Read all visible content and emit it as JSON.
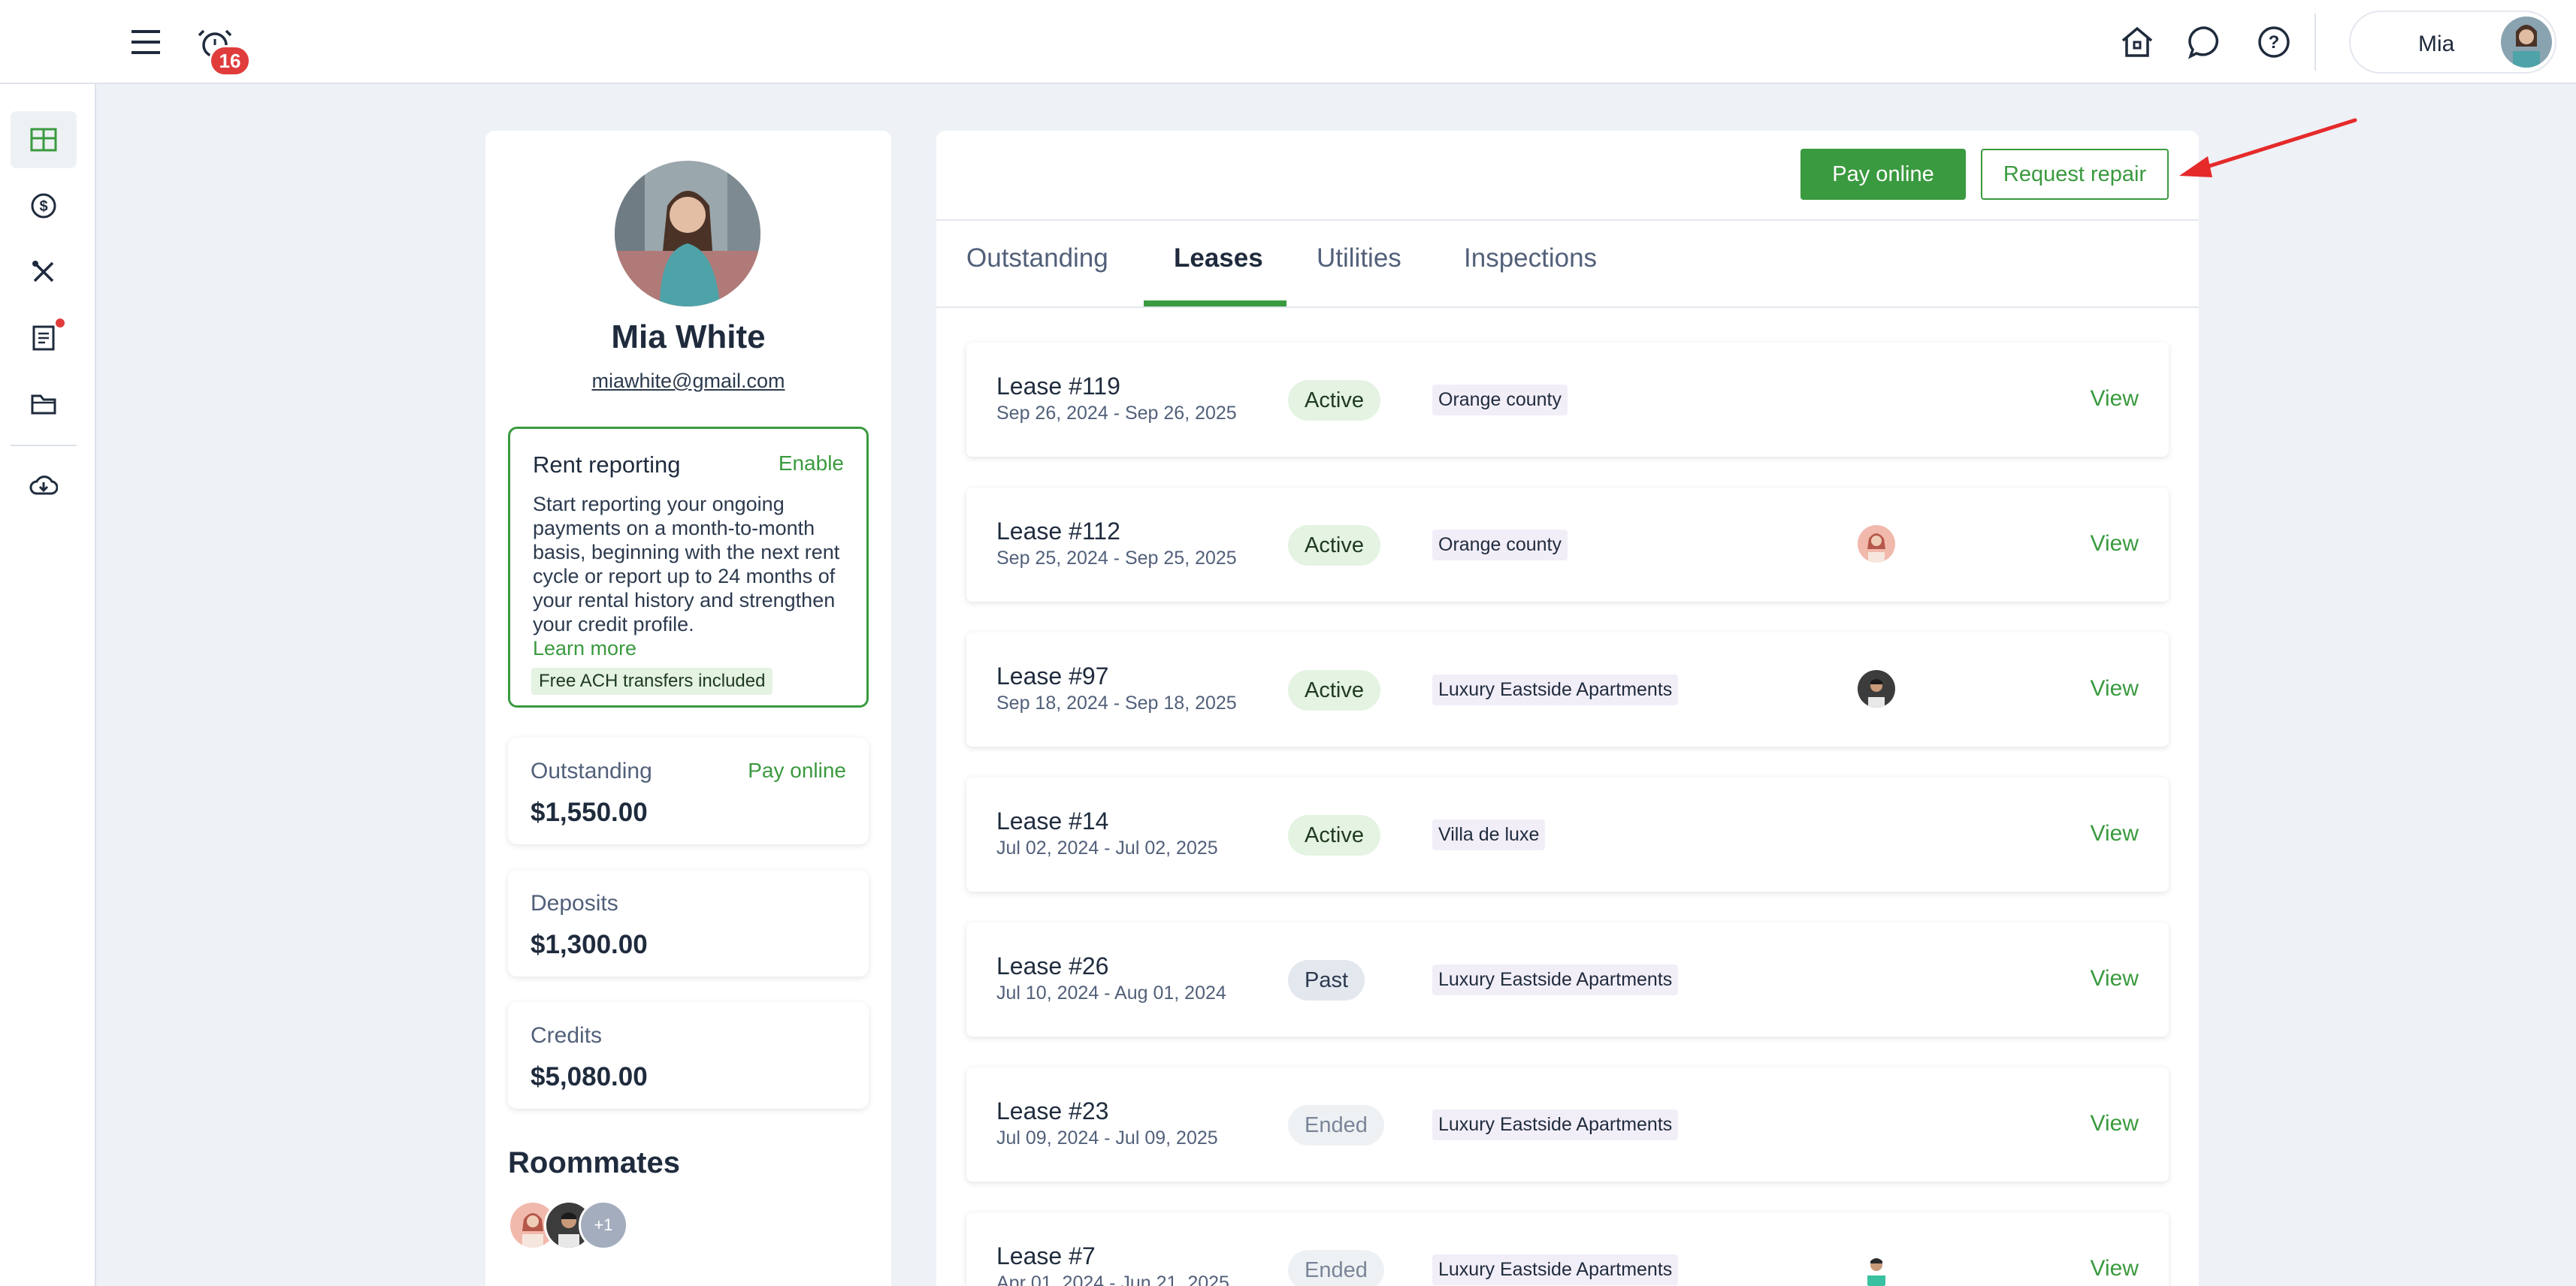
{
  "topbar": {
    "notification_count": "16",
    "user_name": "Mia"
  },
  "profile": {
    "name": "Mia White",
    "email": "miawhite@gmail.com",
    "rent_reporting": {
      "title": "Rent reporting",
      "enable_label": "Enable",
      "description": "Start reporting your ongoing payments on a month-to-month basis, beginning with the next rent cycle or report up to 24 months of your rental history and strengthen your credit profile.",
      "learn_more": "Learn more",
      "ach_note": "Free ACH transfers included"
    },
    "outstanding": {
      "label": "Outstanding",
      "action": "Pay online",
      "value": "$1,550.00"
    },
    "deposits": {
      "label": "Deposits",
      "value": "$1,300.00"
    },
    "credits": {
      "label": "Credits",
      "value": "$5,080.00"
    },
    "roommates": {
      "title": "Roommates",
      "extra": "+1"
    }
  },
  "actions": {
    "pay_online": "Pay online",
    "request_repair": "Request repair"
  },
  "tabs": [
    "Outstanding",
    "Leases",
    "Utilities",
    "Inspections"
  ],
  "leases": [
    {
      "title": "Lease #119",
      "dates": "Sep 26, 2024 - Sep 26, 2025",
      "status": "Active",
      "property": "Orange county",
      "view": "View"
    },
    {
      "title": "Lease #112",
      "dates": "Sep 25, 2024 - Sep 25, 2025",
      "status": "Active",
      "property": "Orange county",
      "view": "View"
    },
    {
      "title": "Lease #97",
      "dates": "Sep 18, 2024 - Sep 18, 2025",
      "status": "Active",
      "property": "Luxury Eastside Apartments",
      "view": "View"
    },
    {
      "title": "Lease #14",
      "dates": "Jul 02, 2024 - Jul 02, 2025",
      "status": "Active",
      "property": "Villa de luxe",
      "view": "View"
    },
    {
      "title": "Lease #26",
      "dates": "Jul 10, 2024 - Aug 01, 2024",
      "status": "Past",
      "property": "Luxury Eastside Apartments",
      "view": "View"
    },
    {
      "title": "Lease #23",
      "dates": "Jul 09, 2024 - Jul 09, 2025",
      "status": "Ended",
      "property": "Luxury Eastside Apartments",
      "view": "View"
    },
    {
      "title": "Lease #7",
      "dates": "Apr 01, 2024 - Jun 21, 2025",
      "status": "Ended",
      "property": "Luxury Eastside Apartments",
      "view": "View"
    }
  ]
}
